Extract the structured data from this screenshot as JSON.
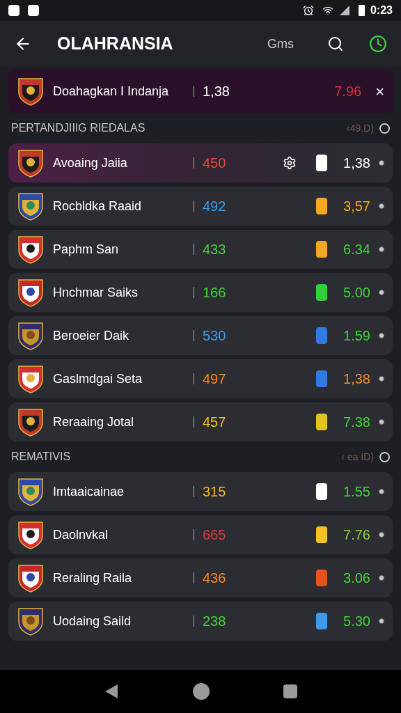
{
  "status_bar": {
    "time": "0:23"
  },
  "app_bar": {
    "title": "OLAHRANSIA",
    "action_label": "Gms"
  },
  "featured": {
    "name": "Doahagkan I Indanja",
    "score": "1,38",
    "odds": "7.96",
    "close": "×"
  },
  "sections": [
    {
      "title": "PERTANDJIIIG RIEDALAS",
      "meta": "‹49.D)",
      "rows": [
        {
          "name": "Avoaing Jaiia",
          "score": {
            "text": "450",
            "color": "#e8453c"
          },
          "color": "#ffffff",
          "odds": {
            "text": "1,38",
            "color": "#ffffff"
          },
          "highlighted": true,
          "kind": "gear"
        },
        {
          "name": "Rocbldka Raaid",
          "score": {
            "text": "492",
            "color": "#3d9be9"
          },
          "color": "#f5a623",
          "odds": {
            "text": "3,57",
            "color": "#f5a623"
          },
          "highlighted": false,
          "kind": "plain"
        },
        {
          "name": "Paphm San",
          "score": {
            "text": "433",
            "color": "#44d13a"
          },
          "color": "#f5a623",
          "odds": {
            "text": "6.34",
            "color": "#44d13a"
          },
          "highlighted": false,
          "kind": "plain"
        },
        {
          "name": "Hnchmar Saiks",
          "score": {
            "text": "166",
            "color": "#44d13a"
          },
          "color": "#2fd13a",
          "odds": {
            "text": "5.00",
            "color": "#44d13a"
          },
          "highlighted": false,
          "kind": "plain"
        },
        {
          "name": "Beroeier Daik",
          "score": {
            "text": "530",
            "color": "#3d9be9"
          },
          "color": "#2f7be3",
          "odds": {
            "text": "1.59",
            "color": "#44d13a"
          },
          "highlighted": false,
          "kind": "plain"
        },
        {
          "name": "Gaslmdgai Seta",
          "score": {
            "text": "497",
            "color": "#f08a2c"
          },
          "color": "#2f7be3",
          "odds": {
            "text": "1,38",
            "color": "#f08a2c"
          },
          "highlighted": false,
          "kind": "plain"
        },
        {
          "name": "Reraaing Jotal",
          "score": {
            "text": "457",
            "color": "#f5c21f"
          },
          "color": "#e5c21c",
          "odds": {
            "text": "7.38",
            "color": "#44d13a"
          },
          "highlighted": false,
          "kind": "plain"
        }
      ]
    },
    {
      "title": "REMATIVIS",
      "meta": "‹ ea ID)",
      "rows": [
        {
          "name": "Imtaaicainae",
          "score": {
            "text": "315",
            "color": "#f5b423"
          },
          "color": "#ffffff",
          "odds": {
            "text": "1.55",
            "color": "#44d13a"
          },
          "highlighted": false,
          "kind": "plain"
        },
        {
          "name": "Daolnvkal",
          "score": {
            "text": "665",
            "color": "#e03a3a"
          },
          "color": "#f5c21f",
          "odds": {
            "text": "7.76",
            "color": "#8fd13a"
          },
          "highlighted": false,
          "kind": "plain"
        },
        {
          "name": "Reraling Raila",
          "score": {
            "text": "436",
            "color": "#f08a2c"
          },
          "color": "#e8521c",
          "odds": {
            "text": "3.06",
            "color": "#44d13a"
          },
          "highlighted": false,
          "kind": "plain"
        },
        {
          "name": "Uodaing Saild",
          "score": {
            "text": "238",
            "color": "#44d13a"
          },
          "color": "#3d9be9",
          "odds": {
            "text": "5.30",
            "color": "#44d13a"
          },
          "highlighted": false,
          "kind": "plain"
        }
      ]
    }
  ]
}
